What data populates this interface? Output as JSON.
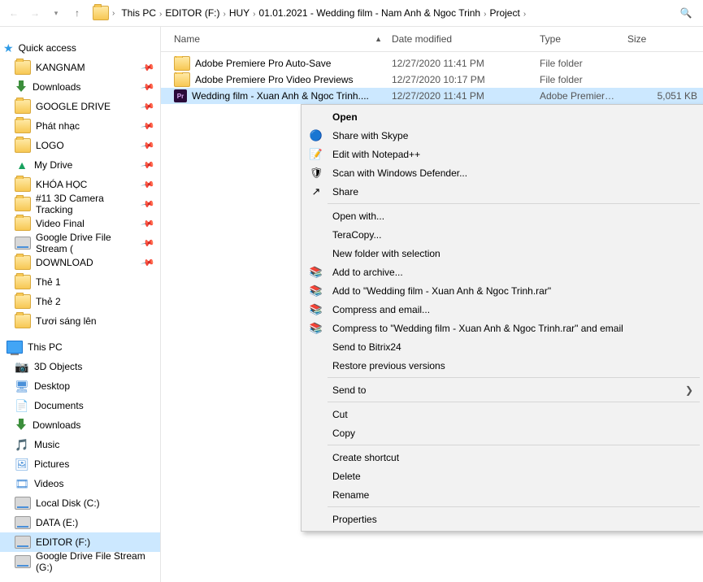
{
  "nav_arrows": {
    "back": "←",
    "fwd": "→",
    "down": "▾",
    "up": "↑"
  },
  "breadcrumb": [
    "This PC",
    "EDITOR (F:)",
    "HUY",
    "01.01.2021 - Wedding film - Nam Anh & Ngoc Trinh",
    "Project"
  ],
  "quick_access": {
    "label": "Quick access",
    "items": [
      {
        "label": "KANGNAM",
        "icon": "folder",
        "pin": true
      },
      {
        "label": "Downloads",
        "icon": "download",
        "pin": true
      },
      {
        "label": "GOOGLE DRIVE",
        "icon": "folder",
        "pin": true
      },
      {
        "label": "Phát nhạc",
        "icon": "folder",
        "pin": true
      },
      {
        "label": "LOGO",
        "icon": "folder",
        "pin": true
      },
      {
        "label": "My Drive",
        "icon": "drive",
        "pin": true
      },
      {
        "label": "KHÓA HỌC",
        "icon": "folder",
        "pin": true
      },
      {
        "label": "#11 3D Camera Tracking",
        "icon": "folder",
        "pin": true
      },
      {
        "label": "Video Final",
        "icon": "folder",
        "pin": true
      },
      {
        "label": "Google Drive File Stream (",
        "icon": "disc",
        "pin": true
      },
      {
        "label": "DOWNLOAD",
        "icon": "folder",
        "pin": true
      },
      {
        "label": "Thẻ 1",
        "icon": "folder",
        "pin": false
      },
      {
        "label": "Thẻ 2",
        "icon": "folder",
        "pin": false
      },
      {
        "label": "Tươi sáng lên",
        "icon": "folder",
        "pin": false
      }
    ]
  },
  "this_pc": {
    "label": "This PC",
    "items": [
      {
        "label": "3D Objects",
        "emoji": "📷",
        "color": "#2aa775"
      },
      {
        "label": "Desktop",
        "emoji": "🖥",
        "color": "#4a90d9"
      },
      {
        "label": "Documents",
        "emoji": "📄",
        "color": "#4a90d9"
      },
      {
        "label": "Downloads",
        "icon": "download"
      },
      {
        "label": "Music",
        "emoji": "🎵",
        "color": "#1976d2"
      },
      {
        "label": "Pictures",
        "emoji": "🖼",
        "color": "#4a90d9"
      },
      {
        "label": "Videos",
        "emoji": "🎞",
        "color": "#4a90d9"
      },
      {
        "label": "Local Disk (C:)",
        "icon": "disc"
      },
      {
        "label": "DATA (E:)",
        "icon": "disc"
      },
      {
        "label": "EDITOR (F:)",
        "icon": "disc",
        "selected": true
      },
      {
        "label": "Google Drive File Stream (G:)",
        "icon": "disc"
      }
    ]
  },
  "columns": {
    "name": "Name",
    "date": "Date modified",
    "type": "Type",
    "size": "Size",
    "w_name": 256,
    "w_date": 170,
    "w_type": 96,
    "w_size": 86
  },
  "rows": [
    {
      "icon": "folder",
      "name": "Adobe Premiere Pro Auto-Save",
      "date": "12/27/2020 11:41 PM",
      "type": "File folder",
      "size": ""
    },
    {
      "icon": "folder",
      "name": "Adobe Premiere Pro Video Previews",
      "date": "12/27/2020 10:17 PM",
      "type": "File folder",
      "size": ""
    },
    {
      "icon": "pr",
      "name": "Wedding film - Xuan Anh & Ngoc Trinh....",
      "date": "12/27/2020 11:41 PM",
      "type": "Adobe Premiere P...",
      "size": "5,051 KB",
      "selected": true
    }
  ],
  "ctx": [
    {
      "t": "item",
      "label": "Open",
      "bold": true
    },
    {
      "t": "item",
      "label": "Share with Skype",
      "icon": "🔵"
    },
    {
      "t": "item",
      "label": "Edit with Notepad++",
      "icon": "📝"
    },
    {
      "t": "item",
      "label": "Scan with Windows Defender...",
      "icon": "🛡"
    },
    {
      "t": "item",
      "label": "Share",
      "icon": "↗"
    },
    {
      "t": "sep"
    },
    {
      "t": "item",
      "label": "Open with..."
    },
    {
      "t": "item",
      "label": "TeraCopy..."
    },
    {
      "t": "item",
      "label": "New folder with selection"
    },
    {
      "t": "item",
      "label": "Add to archive...",
      "icon": "📚"
    },
    {
      "t": "item",
      "label": "Add to \"Wedding film - Xuan Anh & Ngoc Trinh.rar\"",
      "icon": "📚"
    },
    {
      "t": "item",
      "label": "Compress and email...",
      "icon": "📚"
    },
    {
      "t": "item",
      "label": "Compress to \"Wedding film - Xuan Anh & Ngoc Trinh.rar\" and email",
      "icon": "📚"
    },
    {
      "t": "item",
      "label": "Send to Bitrix24"
    },
    {
      "t": "item",
      "label": "Restore previous versions"
    },
    {
      "t": "sep"
    },
    {
      "t": "item",
      "label": "Send to",
      "arrow": true
    },
    {
      "t": "sep"
    },
    {
      "t": "item",
      "label": "Cut"
    },
    {
      "t": "item",
      "label": "Copy"
    },
    {
      "t": "sep"
    },
    {
      "t": "item",
      "label": "Create shortcut"
    },
    {
      "t": "item",
      "label": "Delete"
    },
    {
      "t": "item",
      "label": "Rename"
    },
    {
      "t": "sep"
    },
    {
      "t": "item",
      "label": "Properties"
    }
  ]
}
